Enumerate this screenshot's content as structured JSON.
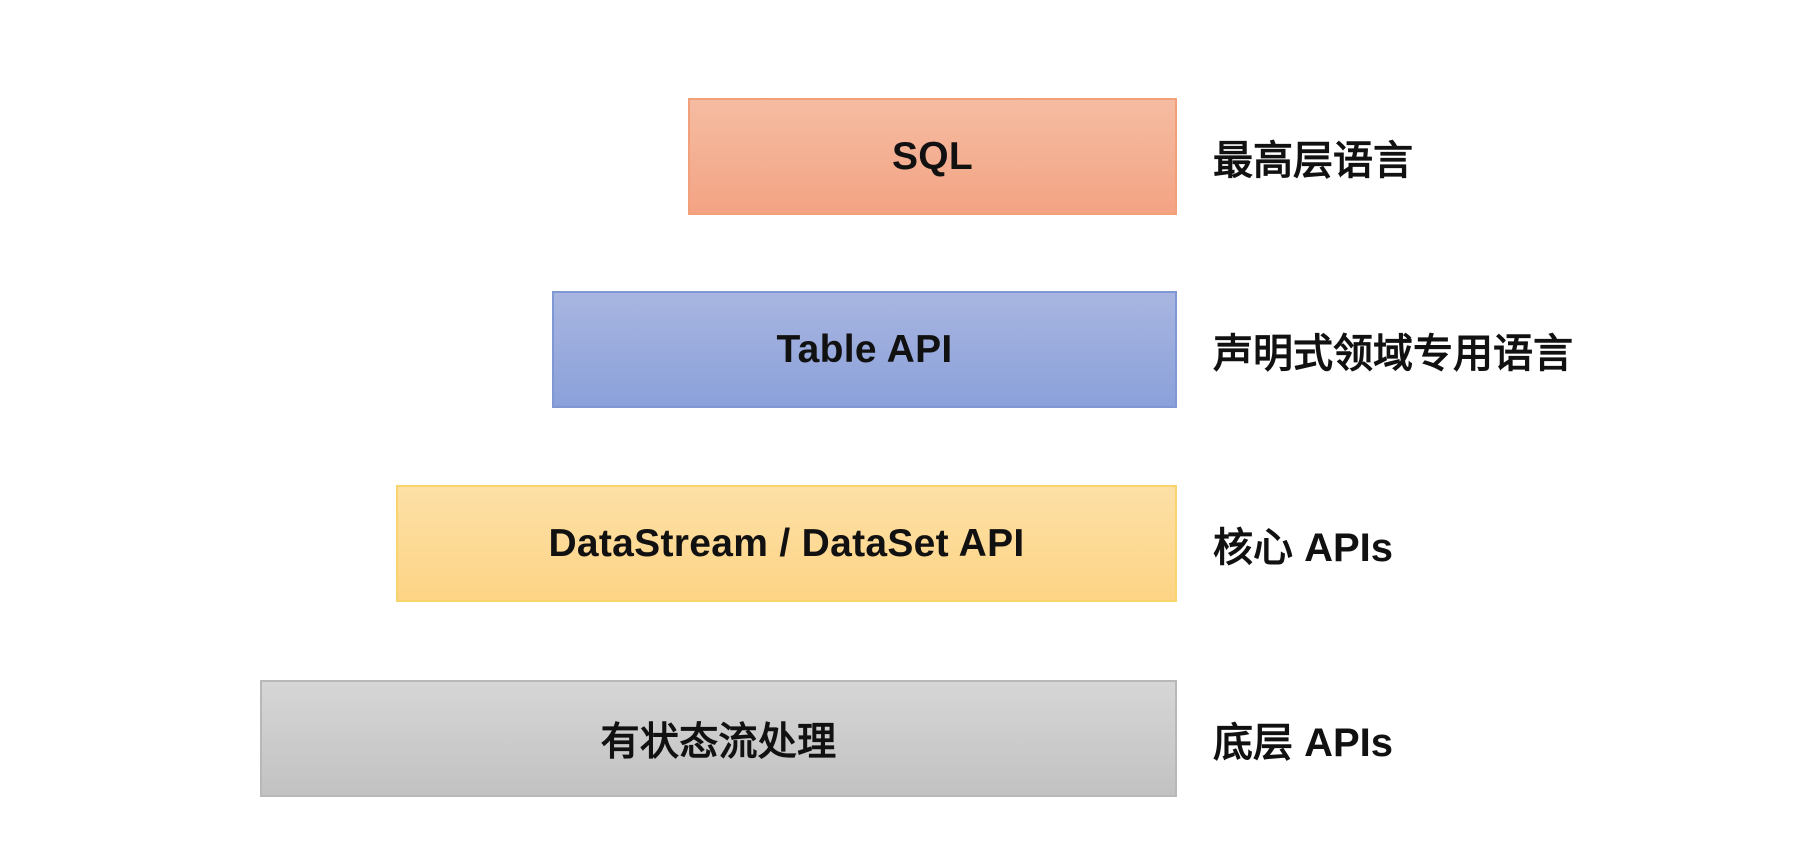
{
  "layers": [
    {
      "label": "SQL",
      "description": "最高层语言",
      "color_top": "#f5bca2",
      "color_bottom": "#f4a383"
    },
    {
      "label": "Table API",
      "description": "声明式领域专用语言",
      "color_top": "#a8b5e0",
      "color_bottom": "#8ba1da"
    },
    {
      "label": "DataStream / DataSet API",
      "description": "核心 APIs",
      "color_top": "#fde0a6",
      "color_bottom": "#fdd485"
    },
    {
      "label": "有状态流处理",
      "description": "底层 APIs",
      "color_top": "#d6d6d6",
      "color_bottom": "#c2c2c2"
    }
  ]
}
